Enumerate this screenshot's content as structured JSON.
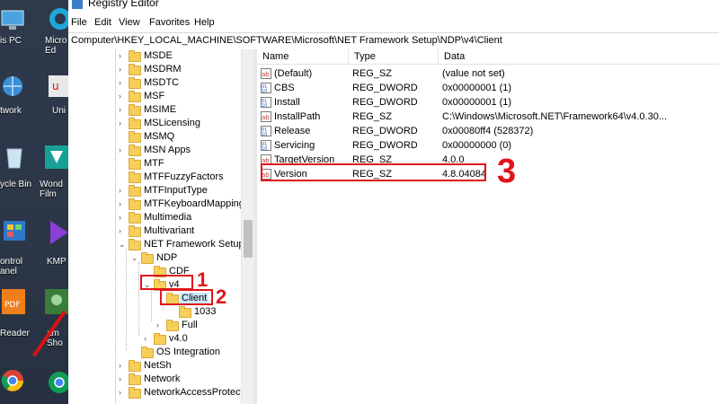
{
  "window": {
    "title": "Registry Editor"
  },
  "menu": [
    "File",
    "Edit",
    "View",
    "Favorites",
    "Help"
  ],
  "address": "Computer\\HKEY_LOCAL_MACHINE\\SOFTWARE\\Microsoft\\NET Framework Setup\\NDP\\v4\\Client",
  "desktop": {
    "labels": [
      "is PC",
      "Micro Ed",
      "twork",
      "Uni",
      "ycle Bin",
      "Wond Film",
      "ontrol anel",
      "KMP",
      "Reader",
      "am Sho"
    ]
  },
  "tree": [
    {
      "label": "MSDE"
    },
    {
      "label": "MSDRM"
    },
    {
      "label": "MSDTC"
    },
    {
      "label": "MSF"
    },
    {
      "label": "MSIME"
    },
    {
      "label": "MSLicensing"
    },
    {
      "label": "MSMQ"
    },
    {
      "label": "MSN Apps"
    },
    {
      "label": "MTF"
    },
    {
      "label": "MTFFuzzyFactors"
    },
    {
      "label": "MTFInputType"
    },
    {
      "label": "MTFKeyboardMappings"
    },
    {
      "label": "Multimedia"
    },
    {
      "label": "Multivariant"
    },
    {
      "label": "NET Framework Setup"
    },
    {
      "label": "NDP"
    },
    {
      "label": "CDF"
    },
    {
      "label": "v4"
    },
    {
      "label": "Client"
    },
    {
      "label": "1033"
    },
    {
      "label": "Full"
    },
    {
      "label": "v4.0"
    },
    {
      "label": "OS Integration"
    },
    {
      "label": "NetSh"
    },
    {
      "label": "Network"
    },
    {
      "label": "NetworkAccessProtectio"
    }
  ],
  "columns": {
    "name": "Name",
    "type": "Type",
    "data": "Data"
  },
  "values": [
    {
      "name": "(Default)",
      "type": "REG_SZ",
      "data": "(value not set)",
      "kind": "sz"
    },
    {
      "name": "CBS",
      "type": "REG_DWORD",
      "data": "0x00000001 (1)",
      "kind": "dword"
    },
    {
      "name": "Install",
      "type": "REG_DWORD",
      "data": "0x00000001 (1)",
      "kind": "dword"
    },
    {
      "name": "InstallPath",
      "type": "REG_SZ",
      "data": "C:\\Windows\\Microsoft.NET\\Framework64\\v4.0.30...",
      "kind": "sz"
    },
    {
      "name": "Release",
      "type": "REG_DWORD",
      "data": "0x00080ff4 (528372)",
      "kind": "dword"
    },
    {
      "name": "Servicing",
      "type": "REG_DWORD",
      "data": "0x00000000 (0)",
      "kind": "dword"
    },
    {
      "name": "TargetVersion",
      "type": "REG_SZ",
      "data": "4.0.0",
      "kind": "sz"
    },
    {
      "name": "Version",
      "type": "REG_SZ",
      "data": "4.8.04084",
      "kind": "sz"
    }
  ],
  "annotations": [
    "1",
    "2",
    "3"
  ],
  "colors": {
    "annotation": "#e0141c",
    "selection": "#cce8ff",
    "folder": "#f6cf5a"
  }
}
